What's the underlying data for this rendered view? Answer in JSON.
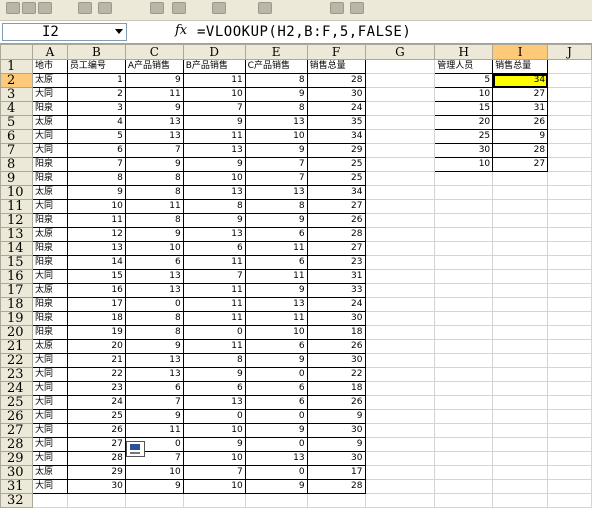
{
  "formula_bar": {
    "name_box": "I2",
    "fx": "fx",
    "formula": "=VLOOKUP(H2,B:F,5,FALSE)"
  },
  "toolbar_icons": [
    "save-icon",
    "print-icon",
    "preview-icon",
    "spell-icon",
    "cut-icon",
    "copy-icon",
    "paste-icon",
    "undo-icon",
    "redo-icon",
    "sort-icon",
    "chart-icon"
  ],
  "columns": [
    "A",
    "B",
    "C",
    "D",
    "E",
    "F",
    "G",
    "H",
    "I",
    "J"
  ],
  "rows": [
    "1",
    "2",
    "3",
    "4",
    "5",
    "6",
    "7",
    "8",
    "9",
    "10",
    "11",
    "12",
    "13",
    "14",
    "15",
    "16",
    "17",
    "18",
    "19",
    "20",
    "21",
    "22",
    "23",
    "24",
    "25",
    "26",
    "27",
    "28",
    "29",
    "30",
    "31",
    "32"
  ],
  "headers": {
    "a": "地市",
    "b": "员工编号",
    "c": "A产品销售",
    "d": "B产品销售",
    "e": "C产品销售",
    "f": "销售总量"
  },
  "records": [
    {
      "a": "太原",
      "b": "1",
      "c": "9",
      "d": "11",
      "e": "8",
      "f": "28"
    },
    {
      "a": "大同",
      "b": "2",
      "c": "11",
      "d": "10",
      "e": "9",
      "f": "30"
    },
    {
      "a": "阳泉",
      "b": "3",
      "c": "9",
      "d": "7",
      "e": "8",
      "f": "24"
    },
    {
      "a": "太原",
      "b": "4",
      "c": "13",
      "d": "9",
      "e": "13",
      "f": "35"
    },
    {
      "a": "大同",
      "b": "5",
      "c": "13",
      "d": "11",
      "e": "10",
      "f": "34"
    },
    {
      "a": "大同",
      "b": "6",
      "c": "7",
      "d": "13",
      "e": "9",
      "f": "29"
    },
    {
      "a": "阳泉",
      "b": "7",
      "c": "9",
      "d": "9",
      "e": "7",
      "f": "25"
    },
    {
      "a": "阳泉",
      "b": "8",
      "c": "8",
      "d": "10",
      "e": "7",
      "f": "25"
    },
    {
      "a": "太原",
      "b": "9",
      "c": "8",
      "d": "13",
      "e": "13",
      "f": "34"
    },
    {
      "a": "大同",
      "b": "10",
      "c": "11",
      "d": "8",
      "e": "8",
      "f": "27"
    },
    {
      "a": "阳泉",
      "b": "11",
      "c": "8",
      "d": "9",
      "e": "9",
      "f": "26"
    },
    {
      "a": "太原",
      "b": "12",
      "c": "9",
      "d": "13",
      "e": "6",
      "f": "28"
    },
    {
      "a": "阳泉",
      "b": "13",
      "c": "10",
      "d": "6",
      "e": "11",
      "f": "27"
    },
    {
      "a": "阳泉",
      "b": "14",
      "c": "6",
      "d": "11",
      "e": "6",
      "f": "23"
    },
    {
      "a": "大同",
      "b": "15",
      "c": "13",
      "d": "7",
      "e": "11",
      "f": "31"
    },
    {
      "a": "太原",
      "b": "16",
      "c": "13",
      "d": "11",
      "e": "9",
      "f": "33"
    },
    {
      "a": "阳泉",
      "b": "17",
      "c": "0",
      "d": "11",
      "e": "13",
      "f": "24"
    },
    {
      "a": "阳泉",
      "b": "18",
      "c": "8",
      "d": "11",
      "e": "11",
      "f": "30"
    },
    {
      "a": "阳泉",
      "b": "19",
      "c": "8",
      "d": "0",
      "e": "10",
      "f": "18"
    },
    {
      "a": "太原",
      "b": "20",
      "c": "9",
      "d": "11",
      "e": "6",
      "f": "26"
    },
    {
      "a": "大同",
      "b": "21",
      "c": "13",
      "d": "8",
      "e": "9",
      "f": "30"
    },
    {
      "a": "大同",
      "b": "22",
      "c": "13",
      "d": "9",
      "e": "0",
      "f": "22"
    },
    {
      "a": "大同",
      "b": "23",
      "c": "6",
      "d": "6",
      "e": "6",
      "f": "18"
    },
    {
      "a": "大同",
      "b": "24",
      "c": "7",
      "d": "13",
      "e": "6",
      "f": "26"
    },
    {
      "a": "大同",
      "b": "25",
      "c": "9",
      "d": "0",
      "e": "0",
      "f": "9"
    },
    {
      "a": "大同",
      "b": "26",
      "c": "11",
      "d": "10",
      "e": "9",
      "f": "30"
    },
    {
      "a": "大同",
      "b": "27",
      "c": "0",
      "d": "9",
      "e": "0",
      "f": "9"
    },
    {
      "a": "大同",
      "b": "28",
      "c": "7",
      "d": "10",
      "e": "13",
      "f": "30"
    },
    {
      "a": "太原",
      "b": "29",
      "c": "10",
      "d": "7",
      "e": "0",
      "f": "17"
    },
    {
      "a": "大同",
      "b": "30",
      "c": "9",
      "d": "10",
      "e": "9",
      "f": "28"
    }
  ],
  "lookup_headers": {
    "h": "管理人员",
    "i": "销售总量"
  },
  "lookup": [
    {
      "h": "5",
      "i": "34"
    },
    {
      "h": "10",
      "i": "27"
    },
    {
      "h": "15",
      "i": "31"
    },
    {
      "h": "20",
      "i": "26"
    },
    {
      "h": "25",
      "i": "9"
    },
    {
      "h": "30",
      "i": "28"
    },
    {
      "h": "10",
      "i": "27"
    }
  ],
  "colors": {
    "selected_header": "#ffc97a",
    "highlight": "#ffff00",
    "sheet_chrome": "#ece9d8"
  }
}
